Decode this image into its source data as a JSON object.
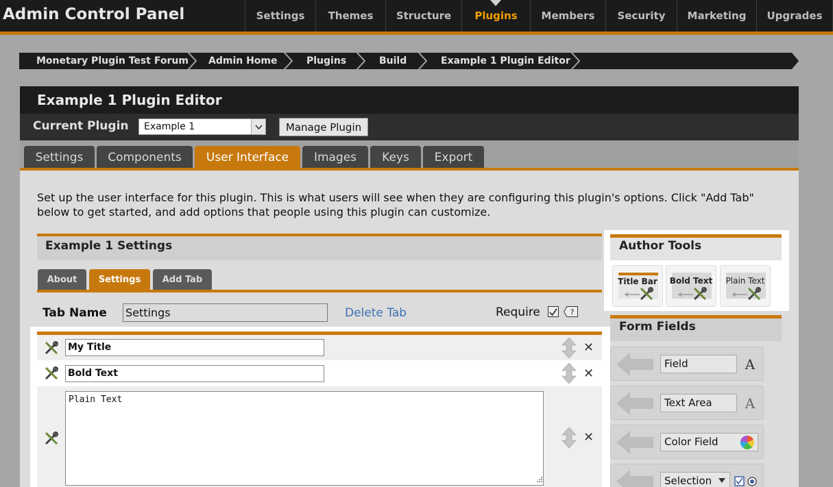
{
  "app": {
    "title": "Admin Control Panel"
  },
  "topnav": {
    "items": [
      "Settings",
      "Themes",
      "Structure",
      "Plugins",
      "Members",
      "Security",
      "Marketing",
      "Upgrades"
    ],
    "active": "Plugins"
  },
  "breadcrumb": [
    "Monetary Plugin Test Forum",
    "Admin Home",
    "Plugins",
    "Build",
    "Example 1 Plugin Editor"
  ],
  "panel": {
    "title": "Example 1 Plugin Editor",
    "current_plugin_label": "Current Plugin",
    "current_plugin_value": "Example 1",
    "manage_button": "Manage Plugin",
    "tabs": [
      "Settings",
      "Components",
      "User Interface",
      "Images",
      "Keys",
      "Export"
    ],
    "active_tab": "User Interface"
  },
  "intro": "Set up the user interface for this plugin. This is what users will see when they are configuring this plugin's options. Click \"Add Tab\" below to get started, and add options that people using this plugin can customize.",
  "settings_section": {
    "title": "Example 1 Settings",
    "tabs": [
      "About",
      "Settings",
      "Add Tab"
    ],
    "active_tab": "Settings",
    "tab_name_label": "Tab Name",
    "tab_name_value": "Settings",
    "delete_tab": "Delete Tab",
    "require_label": "Require",
    "require_checked": true
  },
  "author_tools": {
    "title": "Author Tools",
    "items": [
      "Title Bar",
      "Bold Text",
      "Plain Text"
    ]
  },
  "form_fields": {
    "title": "Form Fields",
    "items": [
      {
        "label": "Field",
        "icon": "font-a-icon"
      },
      {
        "label": "Text Area",
        "icon": "font-a-outline-icon"
      },
      {
        "label": "Color Field",
        "icon": "color-wheel-icon"
      },
      {
        "label": "Selection",
        "icon": "checkbox-radio-icon"
      }
    ]
  },
  "editor_rows": [
    {
      "type": "title",
      "value": "My Title"
    },
    {
      "type": "bold",
      "value": "Bold Text"
    },
    {
      "type": "plain",
      "value": "Plain Text"
    }
  ],
  "colors": {
    "accent": "#c8790e",
    "nav_bg": "#1b1b1b",
    "active_nav": "#f0a000",
    "link": "#3b70b0"
  }
}
